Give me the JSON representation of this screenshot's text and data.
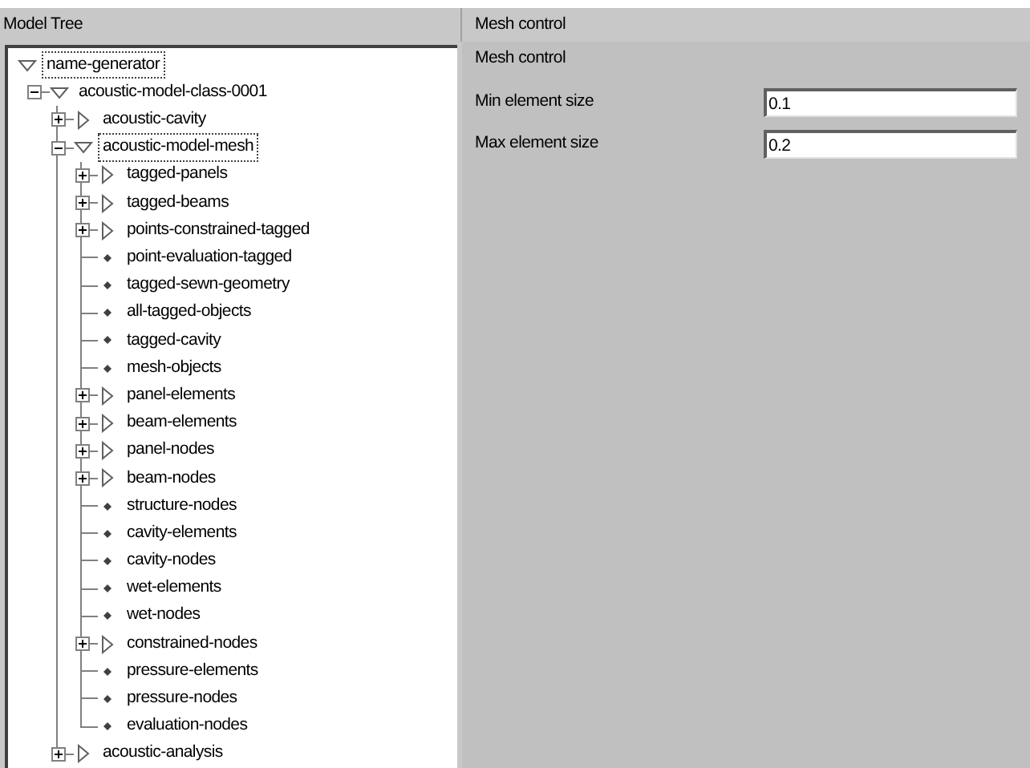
{
  "tree_panel": {
    "title": "Model Tree",
    "nodes": [
      {
        "label": "name-generator",
        "kind": "folder",
        "expanded": true,
        "selected": true,
        "children": [
          {
            "label": "acoustic-model-class-0001",
            "kind": "folder",
            "expanded": true,
            "selected": false,
            "children": [
              {
                "label": "acoustic-cavity",
                "kind": "folder",
                "expanded": false,
                "selected": false
              },
              {
                "label": "acoustic-model-mesh",
                "kind": "folder",
                "expanded": true,
                "selected": true,
                "children": [
                  {
                    "label": "tagged-panels",
                    "kind": "folder",
                    "expanded": false,
                    "selected": false
                  },
                  {
                    "label": "tagged-beams",
                    "kind": "folder",
                    "expanded": false,
                    "selected": false
                  },
                  {
                    "label": "points-constrained-tagged",
                    "kind": "folder",
                    "expanded": false,
                    "selected": false
                  },
                  {
                    "label": "point-evaluation-tagged",
                    "kind": "leaf",
                    "selected": false
                  },
                  {
                    "label": "tagged-sewn-geometry",
                    "kind": "leaf",
                    "selected": false
                  },
                  {
                    "label": "all-tagged-objects",
                    "kind": "leaf",
                    "selected": false
                  },
                  {
                    "label": "tagged-cavity",
                    "kind": "leaf",
                    "selected": false
                  },
                  {
                    "label": "mesh-objects",
                    "kind": "leaf",
                    "selected": false
                  },
                  {
                    "label": "panel-elements",
                    "kind": "folder",
                    "expanded": false,
                    "selected": false
                  },
                  {
                    "label": "beam-elements",
                    "kind": "folder",
                    "expanded": false,
                    "selected": false
                  },
                  {
                    "label": "panel-nodes",
                    "kind": "folder",
                    "expanded": false,
                    "selected": false
                  },
                  {
                    "label": "beam-nodes",
                    "kind": "folder",
                    "expanded": false,
                    "selected": false
                  },
                  {
                    "label": "structure-nodes",
                    "kind": "leaf",
                    "selected": false
                  },
                  {
                    "label": "cavity-elements",
                    "kind": "leaf",
                    "selected": false
                  },
                  {
                    "label": "cavity-nodes",
                    "kind": "leaf",
                    "selected": false
                  },
                  {
                    "label": "wet-elements",
                    "kind": "leaf",
                    "selected": false
                  },
                  {
                    "label": "wet-nodes",
                    "kind": "leaf",
                    "selected": false
                  },
                  {
                    "label": "constrained-nodes",
                    "kind": "folder",
                    "expanded": false,
                    "selected": false
                  },
                  {
                    "label": "pressure-elements",
                    "kind": "leaf",
                    "selected": false
                  },
                  {
                    "label": "pressure-nodes",
                    "kind": "leaf",
                    "selected": false
                  },
                  {
                    "label": "evaluation-nodes",
                    "kind": "leaf",
                    "selected": false
                  }
                ]
              },
              {
                "label": "acoustic-analysis",
                "kind": "folder",
                "expanded": false,
                "selected": false
              }
            ]
          }
        ]
      }
    ]
  },
  "mesh_panel": {
    "title": "Mesh control",
    "heading": "Mesh control",
    "fields": [
      {
        "label": "Min element size",
        "value": "0.1"
      },
      {
        "label": "Max element size",
        "value": "0.2"
      }
    ]
  }
}
